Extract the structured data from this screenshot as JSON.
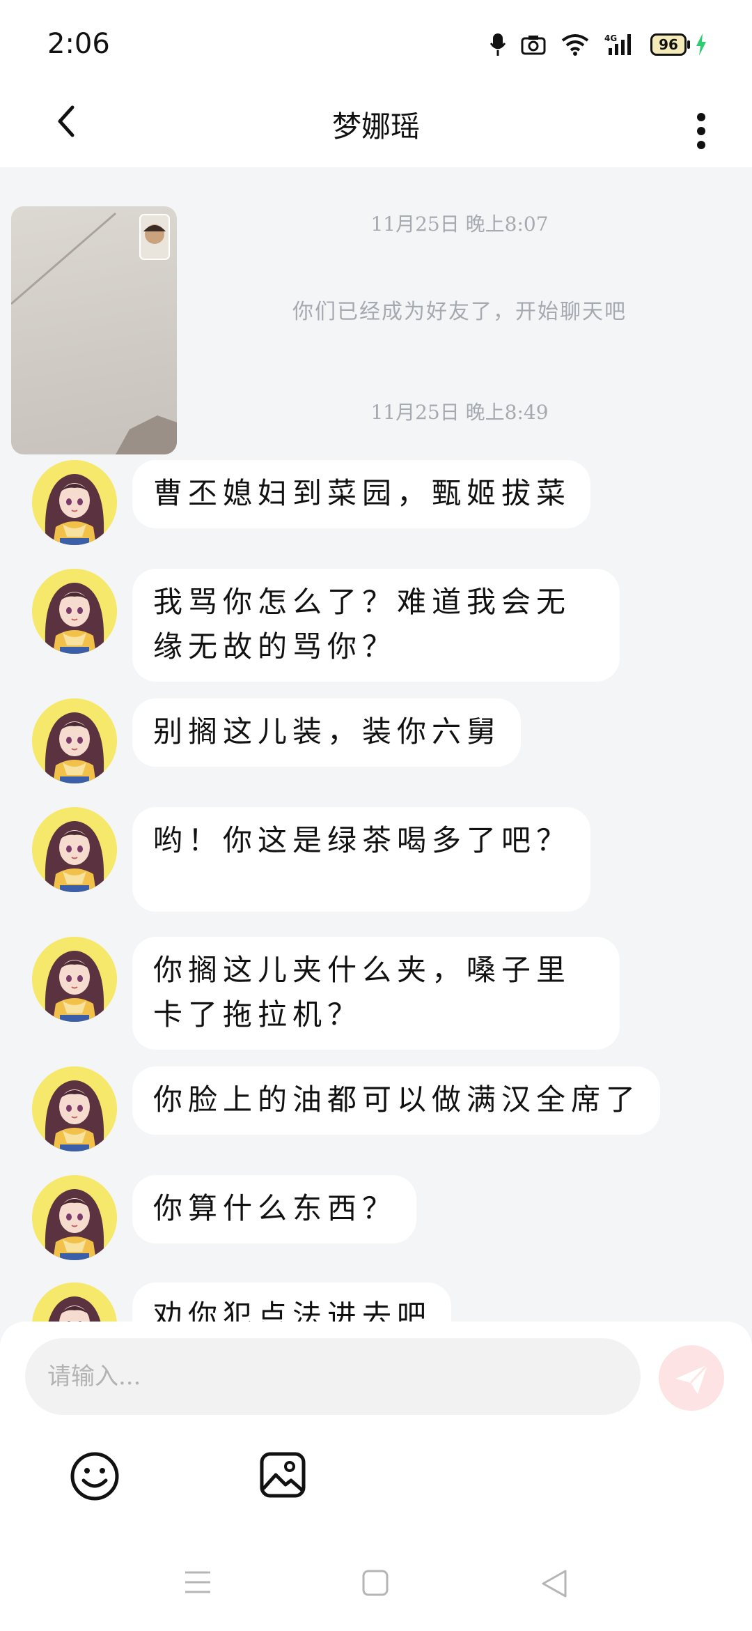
{
  "status_bar": {
    "time": "2:06",
    "battery": "96"
  },
  "header": {
    "title": "梦娜瑶"
  },
  "chat": {
    "timestamp_1": "11月25日 晚上8:07",
    "system_message": "你们已经成为好友了，开始聊天吧",
    "timestamp_2": "11月25日 晚上8:49",
    "messages": [
      {
        "text": "曹丕媳妇到菜园，甄姬拔菜"
      },
      {
        "text": "我骂你怎么了？难道我会无缘无故的骂你？"
      },
      {
        "text": "别搁这儿装，装你六舅"
      },
      {
        "text": "哟！你这是绿茶喝多了吧？"
      },
      {
        "text": "你搁这儿夹什么夹，嗓子里卡了拖拉机？"
      },
      {
        "text": "你脸上的油都可以做满汉全席了"
      },
      {
        "text": "你算什么东西？"
      },
      {
        "text": "劝你犯点法进去吧"
      }
    ]
  },
  "composer": {
    "placeholder": "请输入..."
  },
  "colors": {
    "background": "#f4f5f7",
    "bubble": "#ffffff",
    "send_button": "#fde3e3",
    "charging": "#2ecc71"
  },
  "icons": [
    "back-arrow-icon",
    "more-vertical-icon",
    "emoji-icon",
    "image-icon",
    "send-icon",
    "menu-icon",
    "home-icon",
    "back-triangle-icon"
  ]
}
